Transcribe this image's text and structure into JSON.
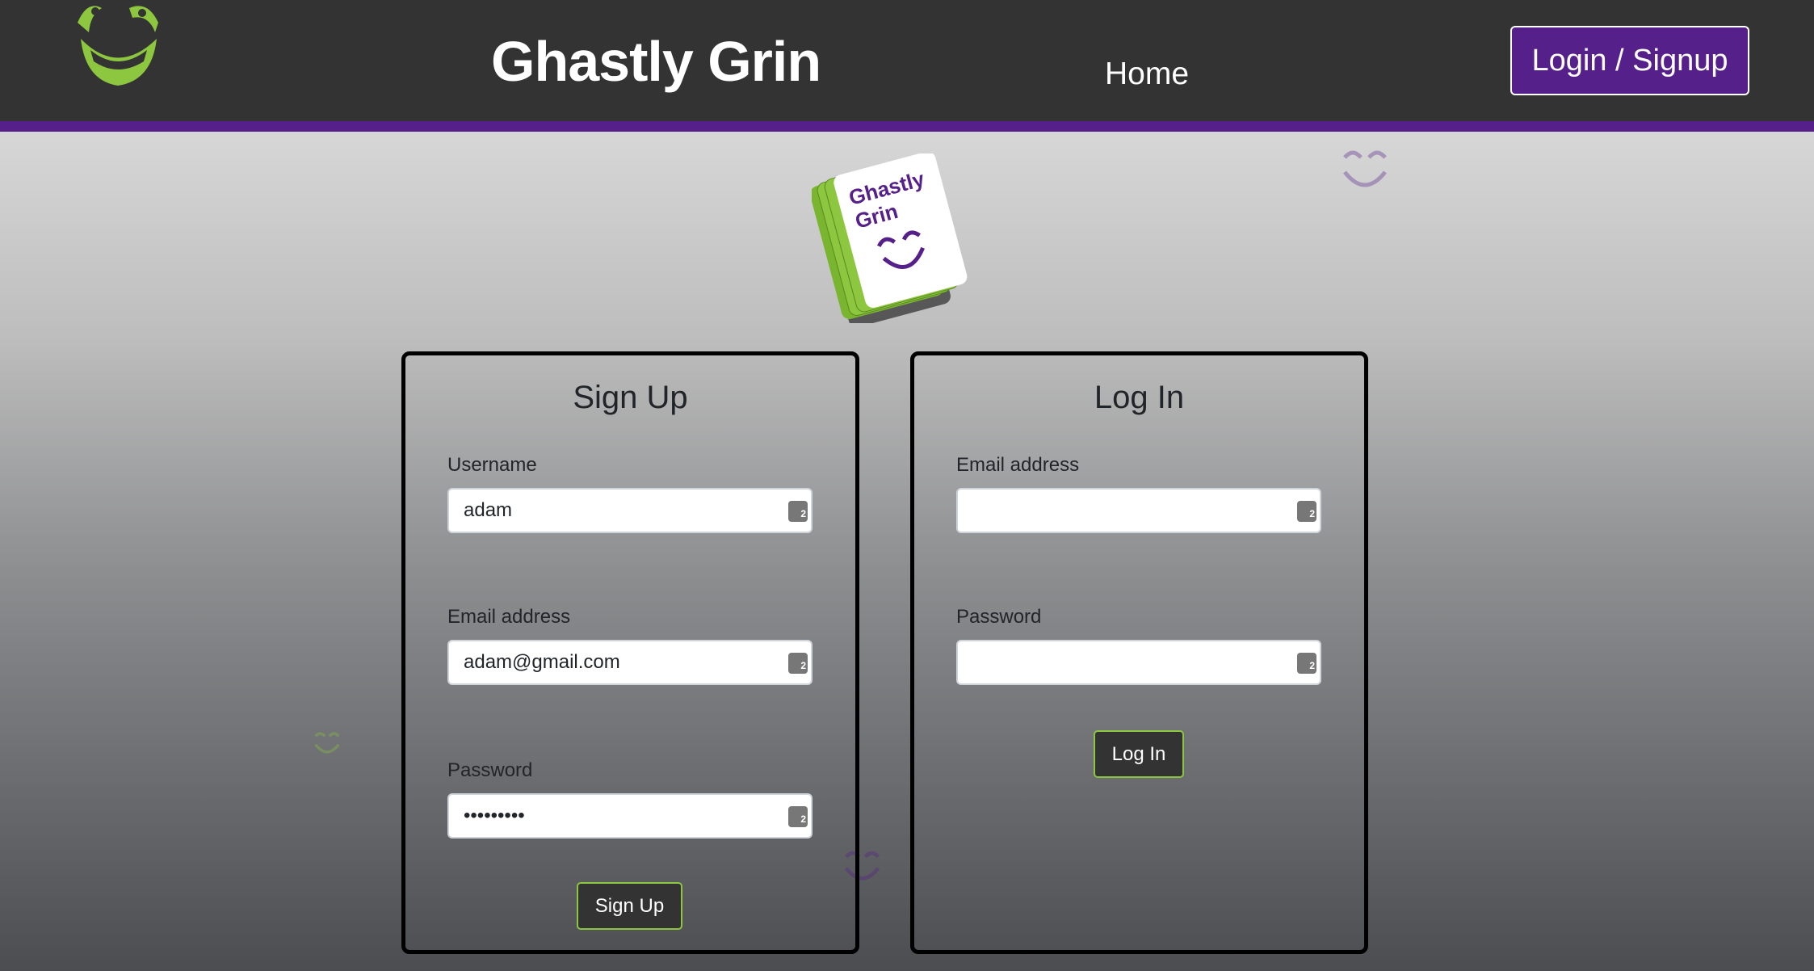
{
  "header": {
    "title": "Ghastly Grin",
    "nav_home": "Home",
    "login_signup": "Login / Signup"
  },
  "logo": {
    "text": "Ghastly Grin"
  },
  "colors": {
    "accent": "#56208a",
    "green": "#8dc63f",
    "header_bg": "#333333"
  },
  "signup": {
    "heading": "Sign Up",
    "username_label": "Username",
    "username_value": "adam",
    "email_label": "Email address",
    "email_value": "adam@gmail.com",
    "password_label": "Password",
    "password_value": "password1",
    "button": "Sign Up"
  },
  "login": {
    "heading": "Log In",
    "email_label": "Email address",
    "email_value": "",
    "password_label": "Password",
    "password_value": "",
    "button": "Log In"
  },
  "icons": {
    "logo": "grinning-face-icon",
    "field": "password-manager-key-icon"
  }
}
